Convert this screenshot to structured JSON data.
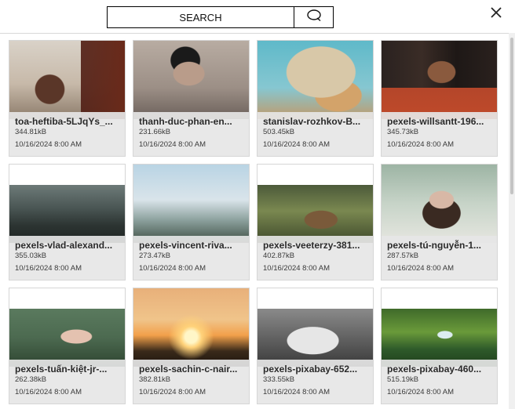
{
  "search": {
    "placeholder": "SEARCH",
    "value": ""
  },
  "icons": {
    "search": "search-icon",
    "close": "close-icon"
  },
  "images": [
    {
      "name": "toa-heftiba-5LJqYs_...",
      "size": "344.81kB",
      "date": "10/16/2024 8:00 AM"
    },
    {
      "name": "thanh-duc-phan-en...",
      "size": "231.66kB",
      "date": "10/16/2024 8:00 AM"
    },
    {
      "name": "stanislav-rozhkov-B...",
      "size": "503.45kB",
      "date": "10/16/2024 8:00 AM"
    },
    {
      "name": "pexels-willsantt-196...",
      "size": "345.73kB",
      "date": "10/16/2024 8:00 AM"
    },
    {
      "name": "pexels-vlad-alexand...",
      "size": "355.03kB",
      "date": "10/16/2024 8:00 AM"
    },
    {
      "name": "pexels-vincent-riva...",
      "size": "273.47kB",
      "date": "10/16/2024 8:00 AM"
    },
    {
      "name": "pexels-veeterzy-381...",
      "size": "402.87kB",
      "date": "10/16/2024 8:00 AM"
    },
    {
      "name": "pexels-tú-nguyễn-1...",
      "size": "287.57kB",
      "date": "10/16/2024 8:00 AM"
    },
    {
      "name": "pexels-tuấn-kiệt-jr-...",
      "size": "262.38kB",
      "date": "10/16/2024 8:00 AM"
    },
    {
      "name": "pexels-sachin-c-nair...",
      "size": "382.81kB",
      "date": "10/16/2024 8:00 AM"
    },
    {
      "name": "pexels-pixabay-652...",
      "size": "333.55kB",
      "date": "10/16/2024 8:00 AM"
    },
    {
      "name": "pexels-pixabay-460...",
      "size": "515.19kB",
      "date": "10/16/2024 8:00 AM"
    }
  ]
}
